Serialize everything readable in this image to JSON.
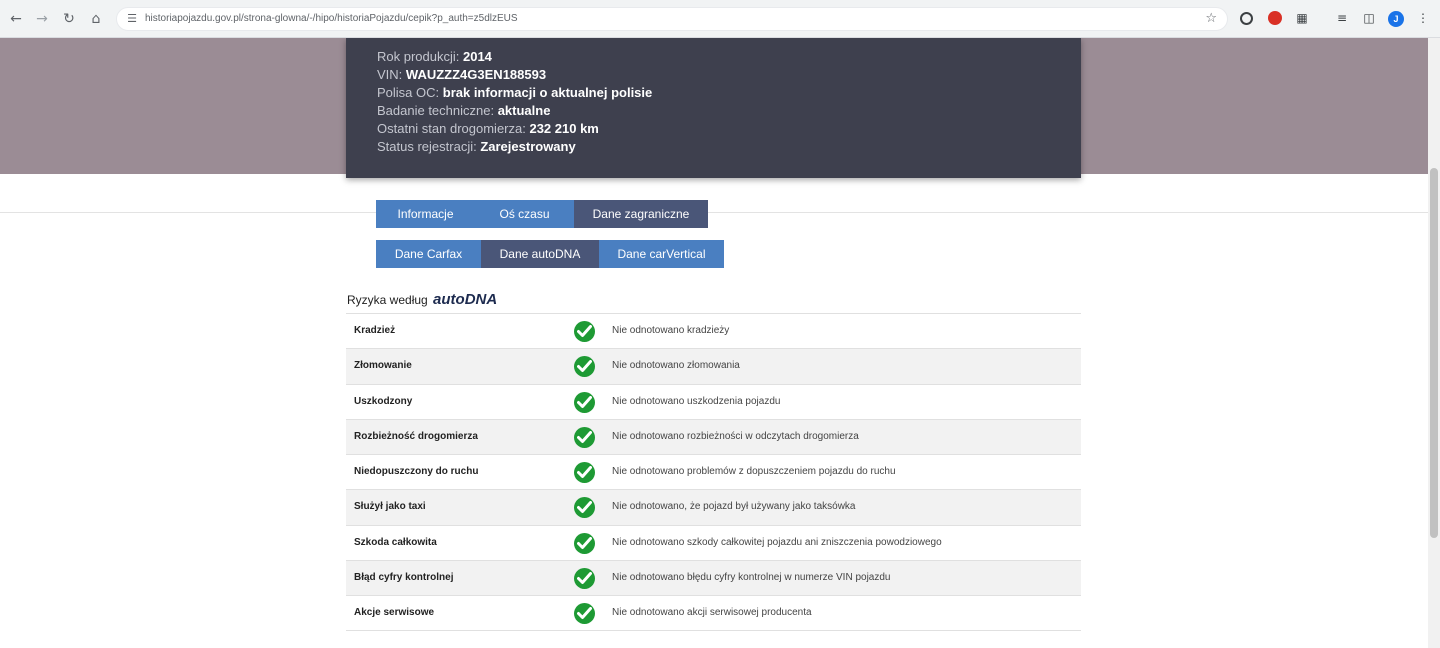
{
  "browser": {
    "url": "historiapojazdu.gov.pl/strona-glowna/-/hipo/historiaPojazdu/cepik?p_auth=z5dlzEUS",
    "avatar_letter": "J",
    "icons": [
      "back-icon",
      "forward-icon",
      "reload-icon",
      "home-icon",
      "site-info-icon",
      "bookmark-star-icon",
      "extension-a-icon",
      "extension-red-icon",
      "extensions-puzzle-icon",
      "reading-list-icon",
      "side-panel-icon",
      "menu-dots-icon"
    ]
  },
  "vehicle": {
    "rows": [
      {
        "label": "Rok produkcji: ",
        "value": "2014"
      },
      {
        "label": "VIN: ",
        "value": "WAUZZZ4G3EN188593"
      },
      {
        "label": "Polisa OC: ",
        "value": "brak informacji o aktualnej polisie"
      },
      {
        "label": "Badanie techniczne: ",
        "value": "aktualne"
      },
      {
        "label": "Ostatni stan drogomierza: ",
        "value": "232 210 km"
      },
      {
        "label": "Status rejestracji: ",
        "value": "Zarejestrowany"
      }
    ]
  },
  "tabs_row1": [
    {
      "label": "Informacje",
      "active": false
    },
    {
      "label": "Oś czasu",
      "active": false
    },
    {
      "label": "Dane zagraniczne",
      "active": true
    }
  ],
  "tabs_row2": [
    {
      "label": "Dane Carfax",
      "active": false
    },
    {
      "label": "Dane autoDNA",
      "active": true
    },
    {
      "label": "Dane carVertical",
      "active": false
    }
  ],
  "risks": {
    "title": "Ryzyka według",
    "brand": "autoDNA",
    "rows": [
      {
        "name": "Kradzież",
        "desc": "Nie odnotowano kradzieży"
      },
      {
        "name": "Złomowanie",
        "desc": "Nie odnotowano złomowania"
      },
      {
        "name": "Uszkodzony",
        "desc": "Nie odnotowano uszkodzenia pojazdu"
      },
      {
        "name": "Rozbieżność drogomierza",
        "desc": "Nie odnotowano rozbieżności w odczytach drogomierza"
      },
      {
        "name": "Niedopuszczony do ruchu",
        "desc": "Nie odnotowano problemów z dopuszczeniem pojazdu do ruchu"
      },
      {
        "name": "Służył jako taxi",
        "desc": "Nie odnotowano, że pojazd był używany jako taksówka"
      },
      {
        "name": "Szkoda całkowita",
        "desc": "Nie odnotowano szkody całkowitej pojazdu ani zniszczenia powodziowego"
      },
      {
        "name": "Błąd cyfry kontrolnej",
        "desc": "Nie odnotowano błędu cyfry kontrolnej w numerze VIN pojazdu"
      },
      {
        "name": "Akcje serwisowe",
        "desc": "Nie odnotowano akcji serwisowej producenta"
      }
    ]
  },
  "colors": {
    "hero_band": "#9b8c95",
    "info_card": "#3e404e",
    "tab_blue": "#4a7fc1",
    "tab_active": "#4a5678",
    "check_green": "#1e9a34"
  }
}
